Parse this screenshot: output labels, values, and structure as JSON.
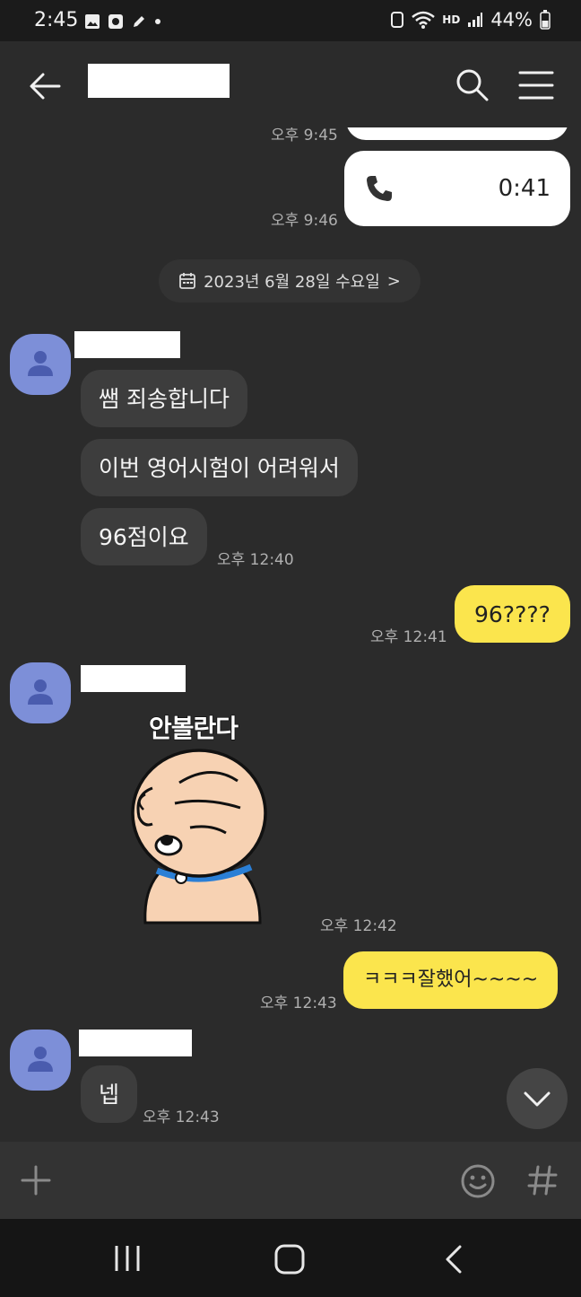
{
  "status_bar": {
    "time": "2:45",
    "battery": "44%",
    "network": "HD"
  },
  "header": {
    "title_redacted": true
  },
  "date_divider": {
    "label": "2023년 6월 28일 수요일",
    "chevron": ">"
  },
  "messages": {
    "prev_partial_time": "오후 9:45",
    "call": {
      "duration": "0:41",
      "time": "오후 9:46"
    },
    "m1": "쌤 죄송합니다",
    "m2": "이번 영어시험이 어려워서",
    "m3": "96점이요",
    "m3_time": "오후 12:40",
    "out1": "96????",
    "out1_time": "오후 12:41",
    "sticker_caption": "안볼란다",
    "sticker_time": "오후 12:42",
    "out2": "ㅋㅋㅋ잘했어~~~~",
    "out2_time": "오후 12:43",
    "reply": "넵",
    "reply_time": "오후 12:43"
  },
  "input_bar": {
    "plus_icon": "plus-icon",
    "emoji_icon": "emoji-icon",
    "hash_icon": "hash-icon"
  },
  "colors": {
    "bg": "#2b2b2b",
    "incoming": "#3d3d3d",
    "outgoing": "#fbe54d",
    "avatar": "#7d8fd8"
  }
}
